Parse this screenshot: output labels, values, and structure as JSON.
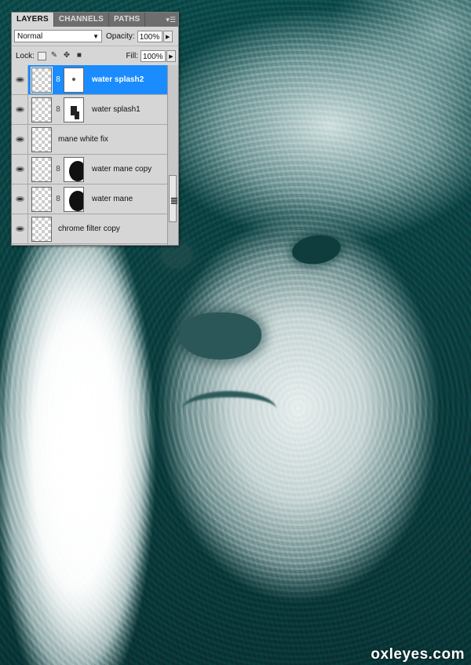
{
  "panel": {
    "tabs": [
      {
        "label": "LAYERS",
        "active": true
      },
      {
        "label": "CHANNELS",
        "active": false
      },
      {
        "label": "PATHS",
        "active": false
      }
    ],
    "menu_icon": "panel-menu-icon",
    "blend_mode": "Normal",
    "opacity_label": "Opacity:",
    "opacity_value": "100%",
    "lock_label": "Lock:",
    "fill_label": "Fill:",
    "fill_value": "100%"
  },
  "layers": [
    {
      "name": "water splash2",
      "selected": true,
      "has_mask": true
    },
    {
      "name": "water splash1",
      "selected": false,
      "has_mask": true
    },
    {
      "name": "mane white fix",
      "selected": false,
      "has_mask": false
    },
    {
      "name": "water mane copy",
      "selected": false,
      "has_mask": true
    },
    {
      "name": "water mane",
      "selected": false,
      "has_mask": true
    },
    {
      "name": "chrome filter copy",
      "selected": false,
      "has_mask": false
    }
  ],
  "colors": {
    "selection": "#1a8cff",
    "panel_bg": "#d6d6d6",
    "tab_bar": "#6e6e6e",
    "background": "#0e4444"
  },
  "watermark": "oxleyes.com"
}
